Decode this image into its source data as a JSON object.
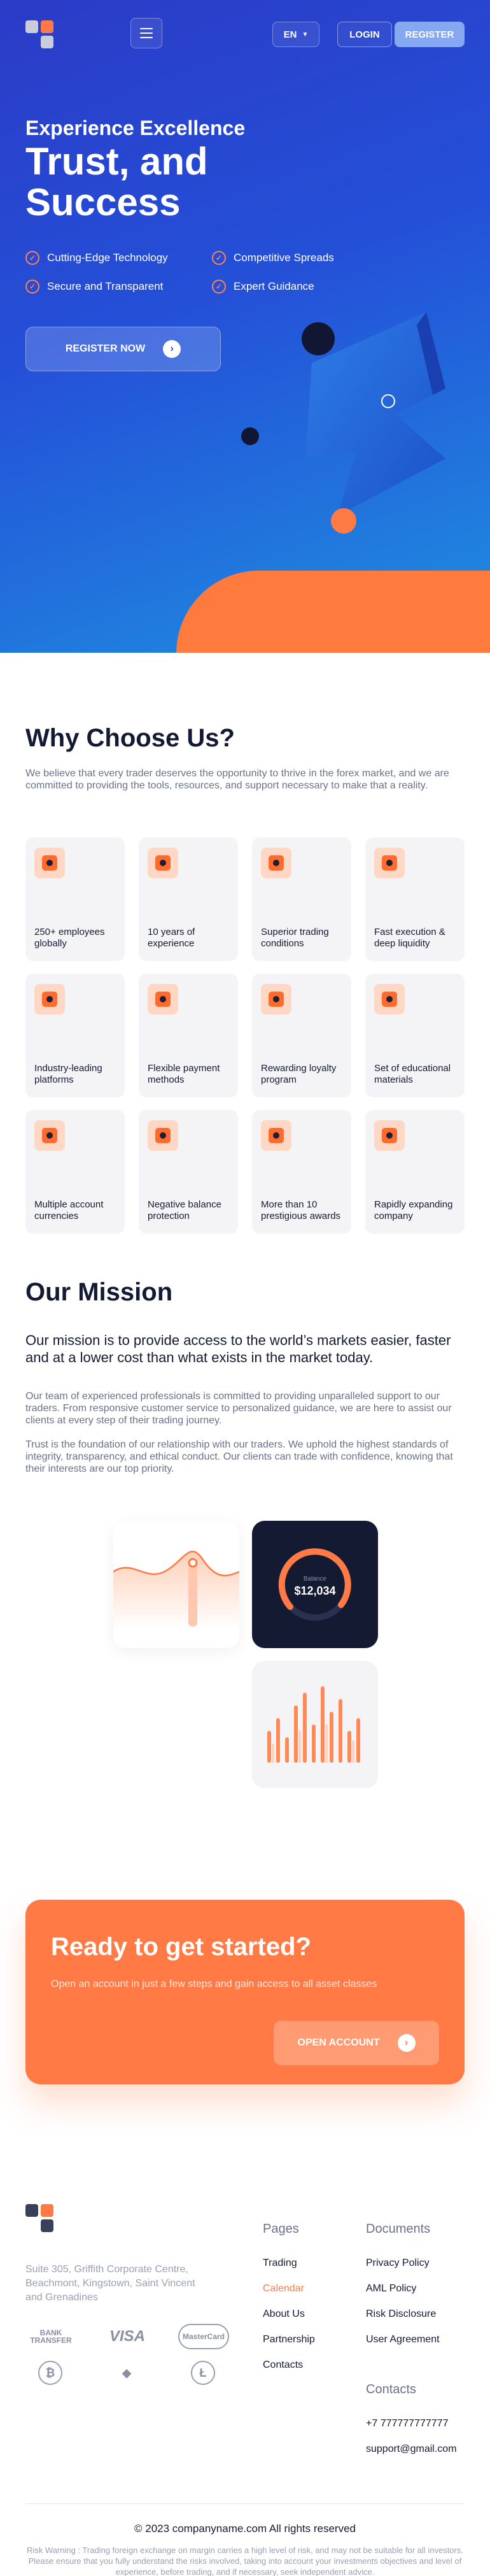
{
  "header": {
    "language": "EN",
    "login_label": "LOGIN",
    "register_label": "REGISTER"
  },
  "hero": {
    "subtitle": "Experience Excellence",
    "title": "Trust, and Success",
    "features": [
      "Cutting-Edge Technology",
      "Competitive Spreads",
      "Secure and Transparent",
      "Expert Guidance"
    ],
    "cta_label": "REGISTER NOW"
  },
  "why": {
    "title": "Why Choose Us?",
    "intro": "We believe that every trader deserves the opportunity to thrive in the forex market, and we are committed to providing the tools, resources, and support necessary to make that a reality.",
    "cards": [
      "250+ employees globally",
      "10 years of experience",
      "Superior trading conditions",
      "Fast execution & deep liquidity",
      "Industry-leading platforms",
      "Flexible payment methods",
      "Rewarding loyalty program",
      "Set of educational materials",
      "Multiple account currencies",
      "Negative balance protection",
      "More than 10 prestigious awards",
      "Rapidly expanding company"
    ]
  },
  "mission": {
    "title": "Our Mission",
    "lead": "Our mission is to provide access to the world’s markets easier, faster and at a lower cost than what exists in the market today.",
    "para1": "Our team of experienced professionals is committed to providing unparalleled support to our traders. From responsive customer service to personalized guidance, we are here to assist our clients at every step of their trading journey.",
    "para2": "Trust is the foundation of our relationship with our traders. We uphold the highest standards of integrity, transparency, and ethical conduct. Our clients can trade with confidence, knowing that their interests are our top priority.",
    "balance_label": "Balance",
    "balance_value": "$12,034"
  },
  "cta": {
    "title": "Ready to get started?",
    "text": "Open an account in just a few steps and gain access to all asset classes",
    "button": "OPEN ACCOUNT"
  },
  "footer": {
    "address": "Suite 305, Griffith Corporate Centre, Beachmont, Kingstown, Saint Vincent and Grenadines",
    "payments": [
      "BANK TRANSFER",
      "VISA",
      "MasterCard"
    ],
    "pages_title": "Pages",
    "pages": [
      "Trading",
      "Calendar",
      "About Us",
      "Partnership",
      "Contacts"
    ],
    "documents_title": "Documents",
    "documents": [
      "Privacy Policy",
      "AML Policy",
      "Risk Disclosure",
      "User Agreement"
    ],
    "contacts_title": "Contacts",
    "phone": "+7 777777777777",
    "email": "support@gmail.com",
    "copyright": "© 2023 companyname.com All rights reserved",
    "risk_warning": "Risk Warning : Trading foreign exchange on margin carries a high level of risk, and may not be suitable for all investors. Please ensure that you fully understand the risks involved, taking into account your investments objectives and level of experience, before trading, and if necessary, seek independent advice."
  },
  "colors": {
    "brand_blue": "#2450d8",
    "accent_orange": "#ff7a45"
  }
}
